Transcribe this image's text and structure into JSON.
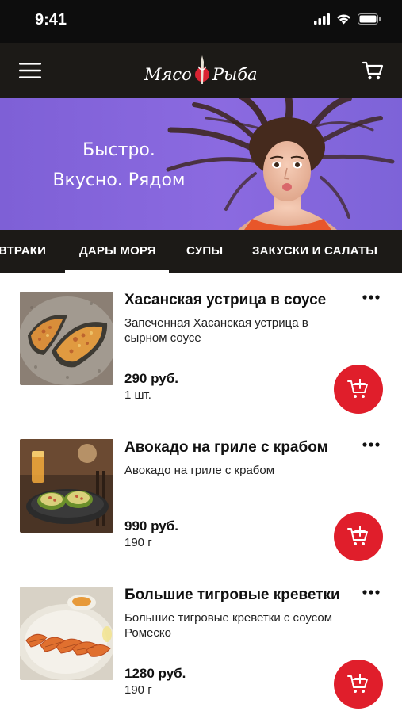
{
  "status_bar": {
    "time": "9:41"
  },
  "header": {
    "brand_left": "Мясо",
    "brand_right": "Рыба"
  },
  "banner": {
    "line1": "Быстро.",
    "line2": "Вкусно. Рядом"
  },
  "tabs": [
    {
      "label": "ВТРАКИ"
    },
    {
      "label": "ДАРЫ МОРЯ"
    },
    {
      "label": "СУПЫ"
    },
    {
      "label": "ЗАКУСКИ И САЛАТЫ"
    }
  ],
  "active_tab": "ДАРЫ МОРЯ",
  "products": [
    {
      "name": "Хасанская устрица в соусе",
      "description": "Запеченная Хасанская устрица в сырном соусе",
      "price": "290 руб.",
      "quantity": "1 шт."
    },
    {
      "name": "Авокадо на гриле с крабом",
      "description": "Авокадо на гриле с крабом",
      "price": "990 руб.",
      "quantity": "190 г"
    },
    {
      "name": "Большие тигровые креветки",
      "description": "Большие тигровые креветки с соусом Ромеско",
      "price": "1280 руб.",
      "quantity": "190 г"
    }
  ],
  "colors": {
    "accent": "#e01e2b",
    "dark": "#1c1a17",
    "banner": "#7e60d6"
  }
}
